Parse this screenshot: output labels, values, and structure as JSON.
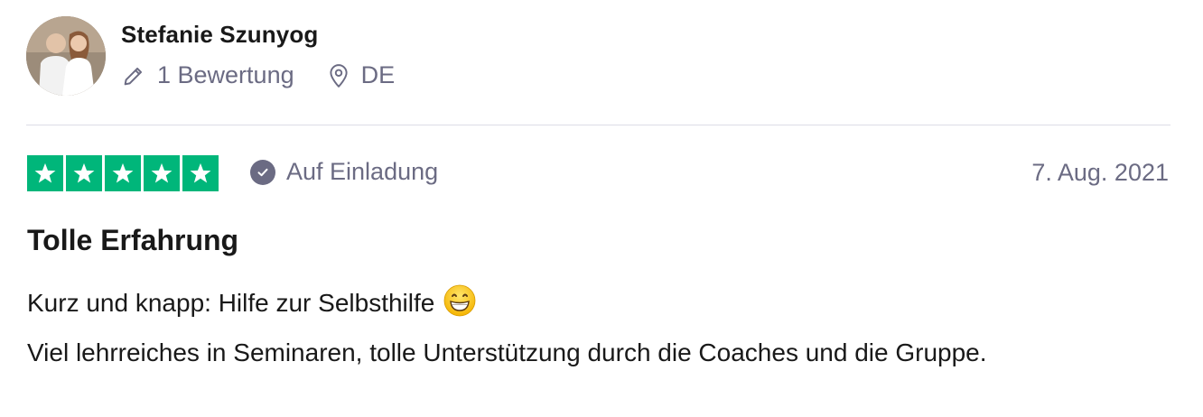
{
  "reviewer": {
    "name": "Stefanie Szunyog",
    "reviews_count": "1 Bewertung",
    "country": "DE"
  },
  "review": {
    "rating": 5,
    "verification": "Auf Einladung",
    "date": "7. Aug. 2021",
    "title": "Tolle Erfahrung",
    "line1": "Kurz und knapp: Hilfe zur Selbsthilfe",
    "line2": "Viel lehrreiches in Seminaren, tolle Unterstützung durch die Coaches und die Gruppe."
  },
  "colors": {
    "star_green": "#00b67a",
    "muted_text": "#6b6b83",
    "text": "#191919",
    "divider": "#dcdce6"
  },
  "icons": {
    "reviews": "pencil-icon",
    "location": "location-pin-icon",
    "verified": "check-circle-icon",
    "emoji": "grinning-emoji-icon"
  }
}
